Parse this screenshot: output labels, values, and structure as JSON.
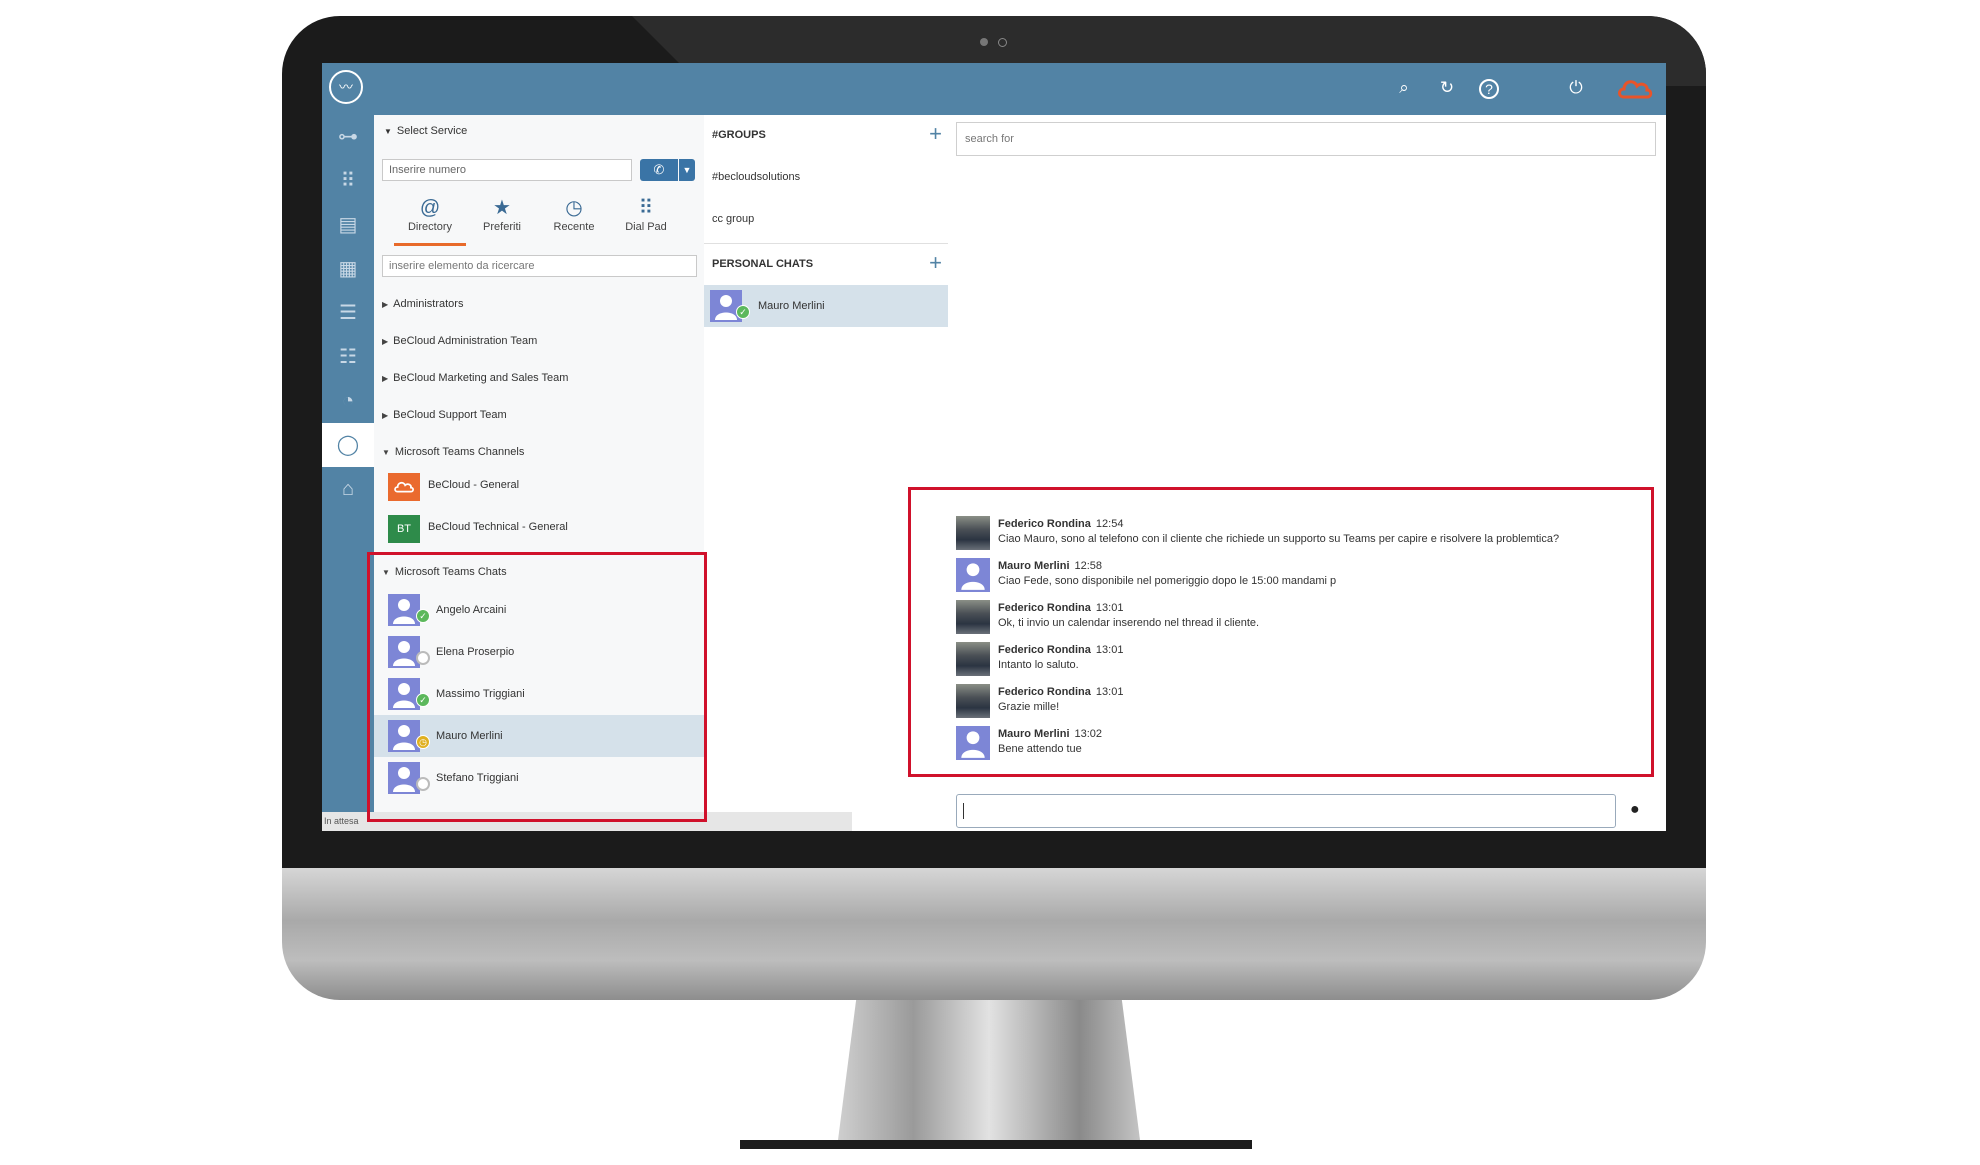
{
  "topbar": {
    "icons": [
      "search-icon",
      "refresh-icon",
      "help-icon",
      "power-icon",
      "cloud-icon"
    ]
  },
  "sidebar": {
    "icons": [
      "toggle-icon",
      "grid-icon",
      "document-icon",
      "calendar-icon",
      "inbox-icon",
      "contacts-icon",
      "chart-icon",
      "chat-icon",
      "home-icon"
    ]
  },
  "directory": {
    "select_service": "Select Service",
    "number_placeholder": "Inserire numero",
    "tabs": [
      {
        "label": "Directory",
        "icon": "at-icon"
      },
      {
        "label": "Preferiti",
        "icon": "star-icon"
      },
      {
        "label": "Recente",
        "icon": "clock-icon"
      },
      {
        "label": "Dial Pad",
        "icon": "dialpad-icon"
      }
    ],
    "search_placeholder": "inserire elemento da ricercare",
    "groups": [
      "Administrators",
      "BeCloud Administration Team",
      "BeCloud Marketing and Sales Team",
      "BeCloud Support Team",
      "Microsoft Teams Channels"
    ],
    "channels": [
      {
        "label": "BeCloud - General",
        "badge": ""
      },
      {
        "label": "BeCloud Technical - General",
        "badge": "BT"
      }
    ],
    "teams_chats_label": "Microsoft Teams Chats",
    "teams_chats": [
      {
        "name": "Angelo Arcaini",
        "status": "available"
      },
      {
        "name": "Elena Proserpio",
        "status": "offline"
      },
      {
        "name": "Massimo Triggiani",
        "status": "available"
      },
      {
        "name": "Mauro Merlini",
        "status": "away"
      },
      {
        "name": "Stefano Triggiani",
        "status": "offline"
      }
    ],
    "statusbar": "In attesa"
  },
  "chats": {
    "groups_label": "#GROUPS",
    "groups": [
      "#becloudsolutions",
      "cc group"
    ],
    "personal_label": "PERSONAL CHATS",
    "personal": [
      {
        "name": "Mauro Merlini",
        "status": "available"
      }
    ]
  },
  "conversation": {
    "search_placeholder": "search for",
    "messages": [
      {
        "author": "Federico Rondina",
        "time": "12:54",
        "text": "Ciao Mauro, sono al telefono con il cliente che richiede un supporto  su Teams per capire e risolvere la problemtica?",
        "avatar": "photo"
      },
      {
        "author": "Mauro Merlini",
        "time": "12:58",
        "text": "Ciao Fede, sono disponibile nel pomeriggio dopo le 15:00 mandami p",
        "avatar": "user"
      },
      {
        "author": "Federico Rondina",
        "time": "13:01",
        "text": "Ok, ti invio un calendar inserendo nel thread il cliente.",
        "avatar": "photo"
      },
      {
        "author": "Federico Rondina",
        "time": "13:01",
        "text": "Intanto lo saluto.",
        "avatar": "photo"
      },
      {
        "author": "Federico Rondina",
        "time": "13:01",
        "text": "Grazie mille!",
        "avatar": "photo"
      },
      {
        "author": "Mauro Merlini",
        "time": "13:02",
        "text": "Bene attendo tue",
        "avatar": "user"
      }
    ]
  },
  "colors": {
    "primary": "#5283a5",
    "highlight": "#d0112b",
    "accent": "#e86a2a",
    "avatar": "#7d86d6"
  }
}
